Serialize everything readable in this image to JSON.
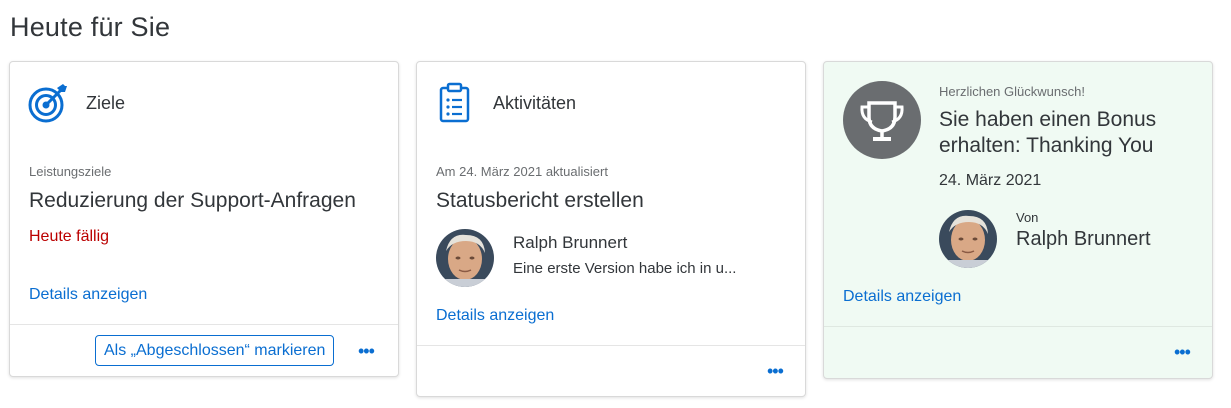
{
  "page": {
    "title": "Heute für Sie"
  },
  "goals_card": {
    "icon": "target-icon",
    "header": "Ziele",
    "category": "Leistungsziele",
    "title": "Reduzierung der Support-Anfragen",
    "status": "Heute fällig",
    "status_color": "#bb0000",
    "details_link": "Details anzeigen",
    "action_button": "Als „Abgeschlossen“ markieren",
    "more": "•••"
  },
  "activities_card": {
    "icon": "clipboard-icon",
    "header": "Aktivitäten",
    "updated": "Am 24. März 2021 aktualisiert",
    "title": "Statusbericht erstellen",
    "person_name": "Ralph Brunnert",
    "message": "Eine erste Version habe ich in u...",
    "details_link": "Details anzeigen",
    "more": "•••"
  },
  "bonus_card": {
    "icon": "trophy-icon",
    "greeting": "Herzlichen Glückwunsch!",
    "title_line1": "Sie haben einen Bonus",
    "title_line2": "erhalten: Thanking You",
    "date": "24. März 2021",
    "from_label": "Von",
    "person_name": "Ralph Brunnert",
    "details_link": "Details anzeigen",
    "background": "#f0faf3",
    "more": "•••"
  },
  "colors": {
    "link": "#0a6ed1",
    "accent_icon": "#0a6ed1",
    "text": "#32363a",
    "muted": "#6a6d70"
  }
}
